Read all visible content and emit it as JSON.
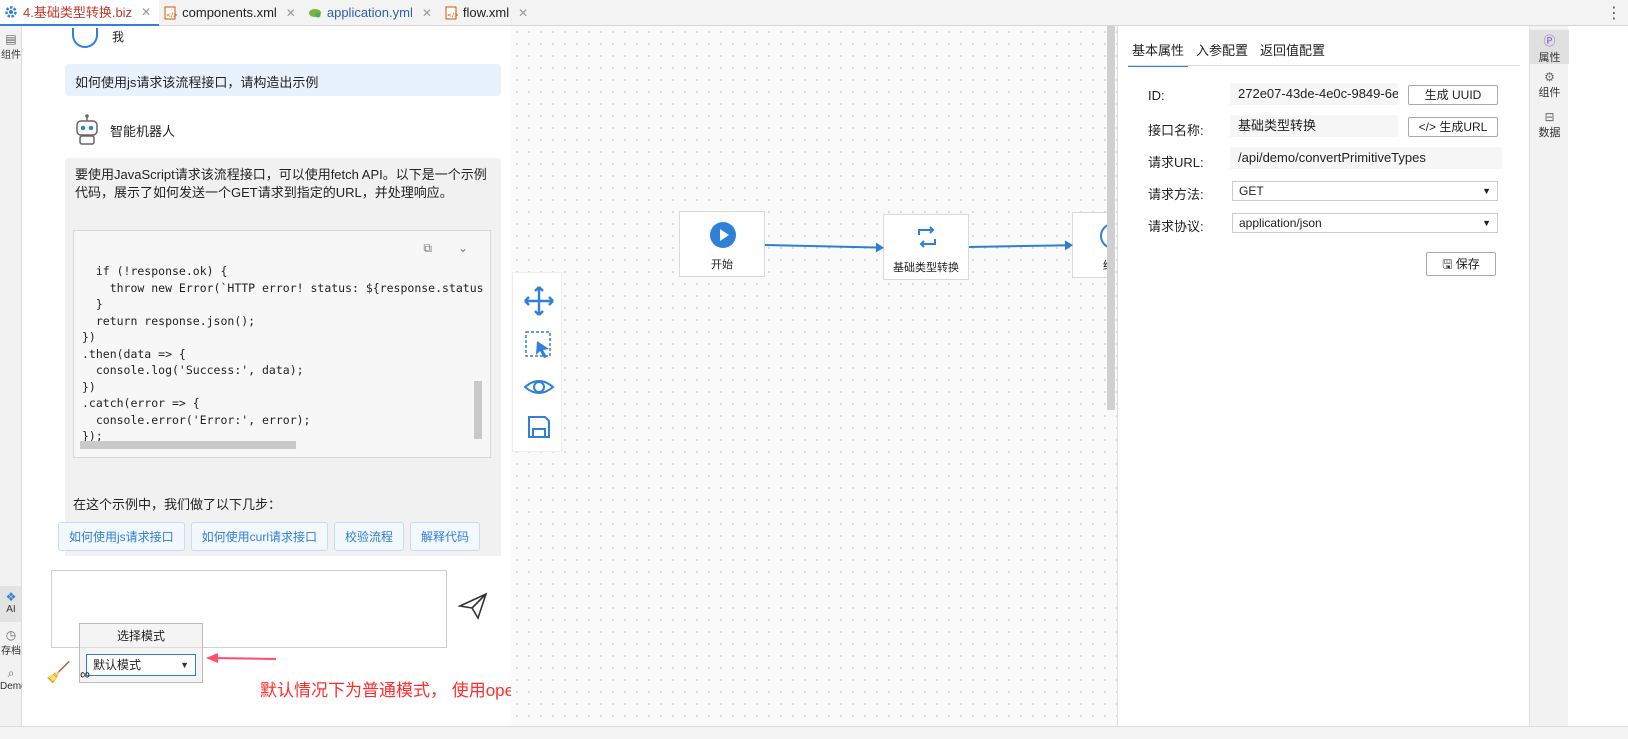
{
  "tabs": [
    {
      "label": "4.基础类型转换.biz",
      "icon": "gear-icon",
      "active": true
    },
    {
      "label": "components.xml",
      "icon": "xml-file-icon"
    },
    {
      "label": "application.yml",
      "icon": "yml-file-icon"
    },
    {
      "label": "flow.xml",
      "icon": "xml-file-icon"
    }
  ],
  "left_strip": {
    "components": "组件",
    "ai": "AI",
    "archive": "存档",
    "demo": "Demo"
  },
  "chat": {
    "me_label": "我",
    "question": "如何使用js请求该流程接口，请构造出示例",
    "bot_name": "智能机器人",
    "answer_intro": "要使用JavaScript请求该流程接口，可以使用fetch API。以下是一个示例代码，展示了如何发送一个GET请求到指定的URL，并处理响应。",
    "code": "  if (!response.ok) {\n    throw new Error(`HTTP error! status: ${response.status\n  }\n  return response.json();\n})\n.then(data => {\n  console.log('Success:', data);\n})\n.catch(error => {\n  console.error('Error:', error);\n});",
    "answer_tail": "在这个示例中，我们做了以下几步：",
    "suggestions": [
      "如何使用js请求接口",
      "如何使用curl请求接口",
      "校验流程",
      "解释代码"
    ],
    "mode_title": "选择模式",
    "mode_value": "默认模式"
  },
  "annotation": "默认情况下为普通模式， 使用openai时是将当前biz文件内容同步发送进行交流。",
  "flow": {
    "nodes": [
      {
        "label": "开始"
      },
      {
        "label": "基础类型转换"
      },
      {
        "label": "结"
      }
    ]
  },
  "props": {
    "tabs": [
      "基本属性",
      "入参配置",
      "返回值配置"
    ],
    "id_label": "ID:",
    "id_value": "272e07-43de-4e0c-9849-6e",
    "gen_uuid": "生成 UUID",
    "name_label": "接口名称:",
    "name_value": "基础类型转换",
    "gen_url": "生成URL",
    "url_label": "请求URL:",
    "url_value": "/api/demo/convertPrimitiveTypes",
    "method_label": "请求方法:",
    "method_value": "GET",
    "protocol_label": "请求协议:",
    "protocol_value": "application/json",
    "save": "保存"
  },
  "right_strip": {
    "attributes": "属性",
    "components": "组件",
    "data": "数据"
  },
  "colors": {
    "accent": "#2f80d6",
    "annotation": "#ff2d2d"
  }
}
